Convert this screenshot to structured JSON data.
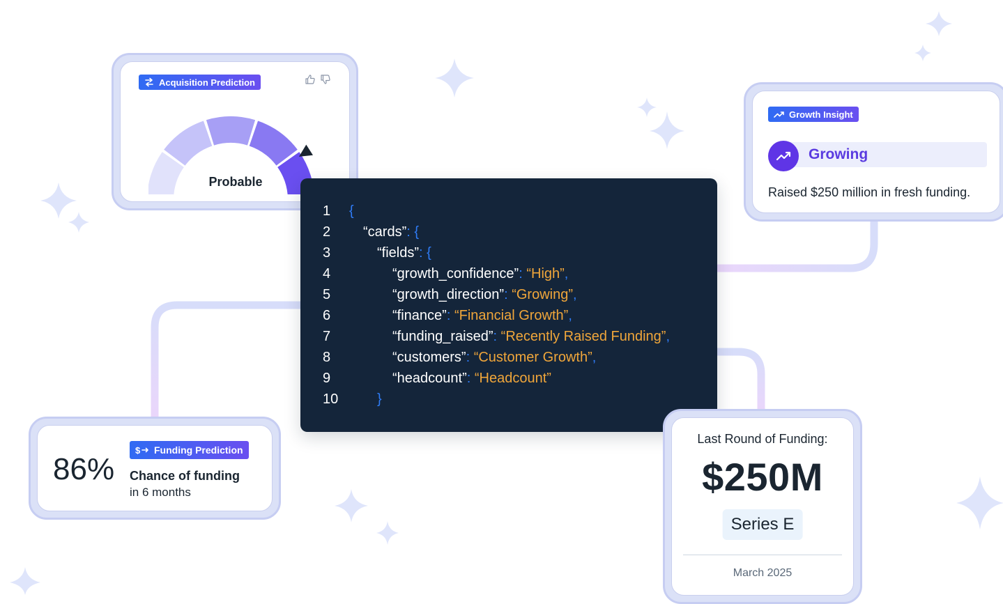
{
  "acquisition_card": {
    "badge_label": "Acquisition Prediction",
    "badge_icon": "arrows-exchange-icon",
    "gauge_label": "Probable",
    "gauge_level": 0.82,
    "gauge_colors": [
      "#e1e2fb",
      "#c5c3f9",
      "#a79ff5",
      "#8979f2",
      "#6a4ff0"
    ]
  },
  "growth_card": {
    "badge_label": "Growth Insight",
    "badge_icon": "trending-up-icon",
    "status": "Growing",
    "description": "Raised $250 million in fresh funding."
  },
  "code_panel": {
    "lines": [
      {
        "num": "1",
        "key": "",
        "value": "",
        "open": "{",
        "close": ""
      },
      {
        "num": "2",
        "key": "“cards”",
        "value": "",
        "open": "{",
        "close": ""
      },
      {
        "num": "3",
        "key": "“fields”",
        "value": "",
        "open": "{",
        "close": ""
      },
      {
        "num": "4",
        "key": "“growth_confidence”",
        "value": "“High”",
        "open": "",
        "close": ","
      },
      {
        "num": "5",
        "key": "“growth_direction”",
        "value": "“Growing”",
        "open": "",
        "close": ","
      },
      {
        "num": "6",
        "key": "“finance”",
        "value": "“Financial Growth”",
        "open": "",
        "close": ","
      },
      {
        "num": "7",
        "key": "“funding_raised”",
        "value": "“Recently Raised Funding”",
        "open": "",
        "close": ","
      },
      {
        "num": "8",
        "key": "“customers”",
        "value": "“Customer Growth”",
        "open": "",
        "close": ","
      },
      {
        "num": "9",
        "key": "“headcount”",
        "value": "“Headcount”",
        "open": "",
        "close": ""
      },
      {
        "num": "10",
        "key": "",
        "value": "",
        "open": "}",
        "close": ""
      }
    ],
    "colors": {
      "key": "#ffffff",
      "punct": "#2f7cf6",
      "value": "#f0a63a"
    }
  },
  "funding_card": {
    "percent": "86%",
    "badge_label": "Funding Prediction",
    "badge_icon": "dollar-arrow-icon",
    "title": "Chance of funding",
    "subtitle": "in 6 months"
  },
  "round_card": {
    "title": "Last Round of Funding:",
    "amount": "$250M",
    "series": "Series E",
    "date": "March 2025"
  },
  "colors": {
    "accent_blue": "#2f6bf3",
    "accent_purple": "#6a4ff0",
    "code_background": "#14253a",
    "frame": "#dbe1f7"
  }
}
